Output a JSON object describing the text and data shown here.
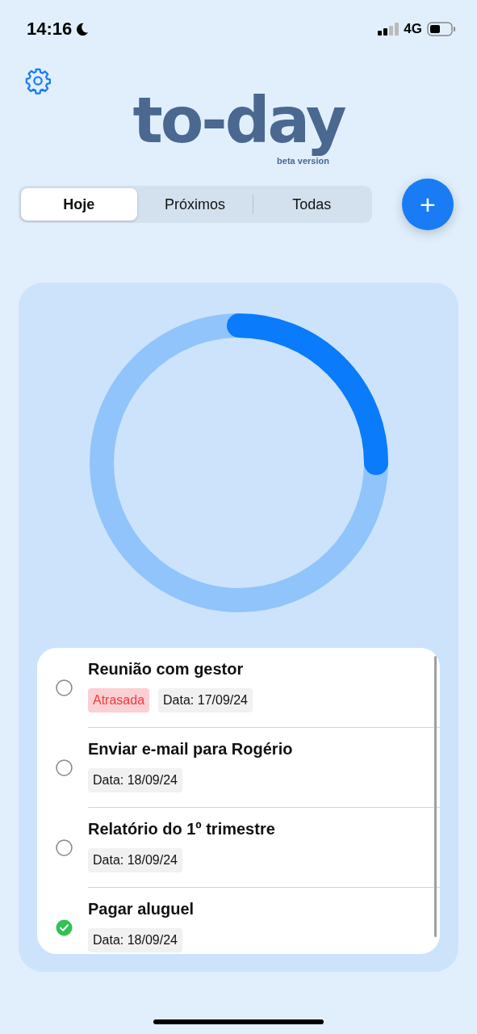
{
  "status_bar": {
    "time": "14:16",
    "network": "4G"
  },
  "logo": {
    "title": "to-day",
    "subtitle": "beta version"
  },
  "tabs": [
    {
      "label": "Hoje",
      "selected": true
    },
    {
      "label": "Próximos",
      "selected": false
    },
    {
      "label": "Todas",
      "selected": false
    }
  ],
  "add_button": {
    "label": "+"
  },
  "progress": {
    "level": 0.25
  },
  "tasks": [
    {
      "title": "Reunião com gestor",
      "checked": false,
      "tags": [
        {
          "kind": "overdue",
          "text": "Atrasada"
        },
        {
          "kind": "date",
          "text": "Data: 17/09/24"
        }
      ]
    },
    {
      "title": "Enviar e-mail para Rogério",
      "checked": false,
      "tags": [
        {
          "kind": "date",
          "text": "Data: 18/09/24"
        }
      ]
    },
    {
      "title": "Relatório do 1º trimestre",
      "checked": false,
      "tags": [
        {
          "kind": "date",
          "text": "Data: 18/09/24"
        }
      ]
    },
    {
      "title": "Pagar aluguel",
      "checked": true,
      "tags": [
        {
          "kind": "date",
          "text": "Data: 18/09/24"
        }
      ]
    }
  ]
}
